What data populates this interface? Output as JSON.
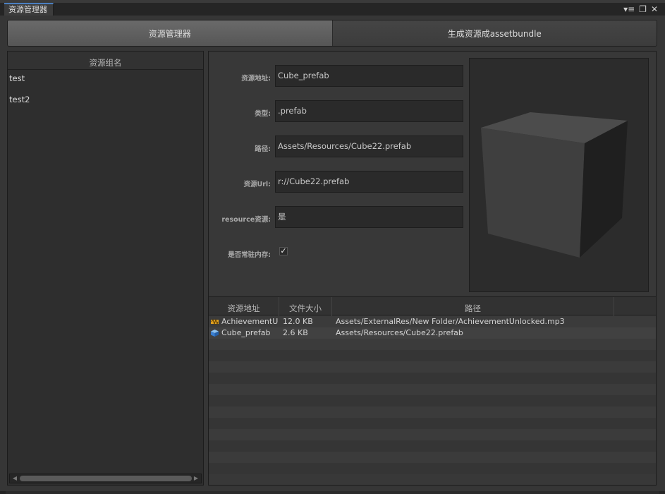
{
  "window": {
    "tab_title": "资源管理器",
    "controls": {
      "menu": "▾≡",
      "maximize": "❐",
      "close": "✕"
    }
  },
  "toolbar": {
    "tabs": [
      {
        "label": "资源管理器",
        "active": true
      },
      {
        "label": "生成资源成assetbundle",
        "active": false
      }
    ]
  },
  "groups": {
    "header": "资源组名",
    "items": [
      "test",
      "test2"
    ]
  },
  "details": {
    "fields": [
      {
        "label": "资源地址:",
        "value": "Cube_prefab"
      },
      {
        "label": "类型:",
        "value": ".prefab"
      },
      {
        "label": "路径:",
        "value": "Assets/Resources/Cube22.prefab"
      },
      {
        "label": "资源Url:",
        "value": "r://Cube22.prefab"
      },
      {
        "label": "resource资源:",
        "value": "是"
      }
    ],
    "resident_label": "是否常驻内存:",
    "resident_checked": true,
    "preview_icon": "cube-preview"
  },
  "asset_list": {
    "columns": [
      "资源地址",
      "文件大小",
      "路径"
    ],
    "rows": [
      {
        "icon": "audio-clip-icon",
        "name": "AchievementU",
        "size": "12.0 KB",
        "path": "Assets/ExternalRes/New Folder/AchievementUnlocked.mp3"
      },
      {
        "icon": "prefab-cube-icon",
        "name": "Cube_prefab",
        "size": "2.6 KB",
        "path": "Assets/Resources/Cube22.prefab"
      }
    ]
  },
  "colors": {
    "accent": "#4b7fc0",
    "panel": "#383838",
    "field_bg": "#2a2a2a"
  }
}
